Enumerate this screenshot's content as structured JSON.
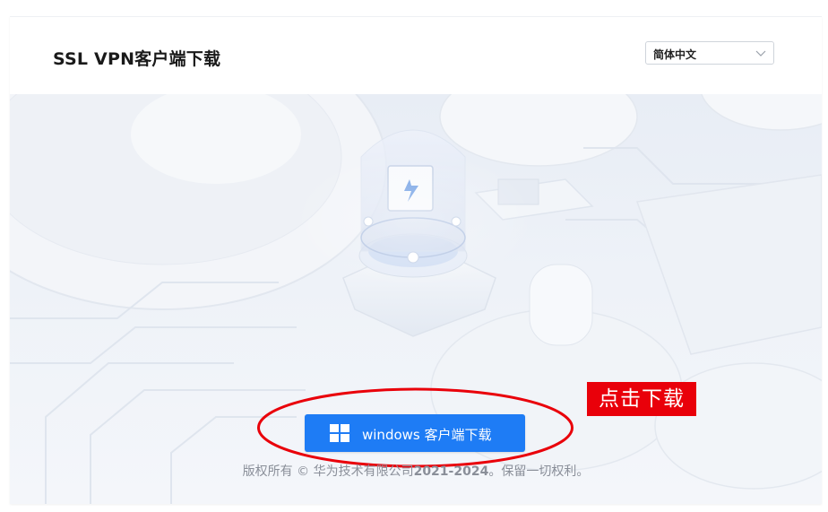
{
  "header": {
    "title": "SSL VPN客户端下载",
    "language": {
      "selected": "简体中文"
    }
  },
  "main": {
    "download_button": {
      "label": "windows 客户端下载",
      "icon": "windows-logo-icon"
    },
    "annotation": {
      "callout_text": "点击下载",
      "color": "#e9000a"
    },
    "footer": {
      "prefix": "版权所有 © 华为技术有限公司",
      "years": "2021-2024",
      "suffix": "。保留一切权利。"
    }
  },
  "colors": {
    "primary_button": "#1e7cf5",
    "annotation_red": "#e9000a"
  }
}
